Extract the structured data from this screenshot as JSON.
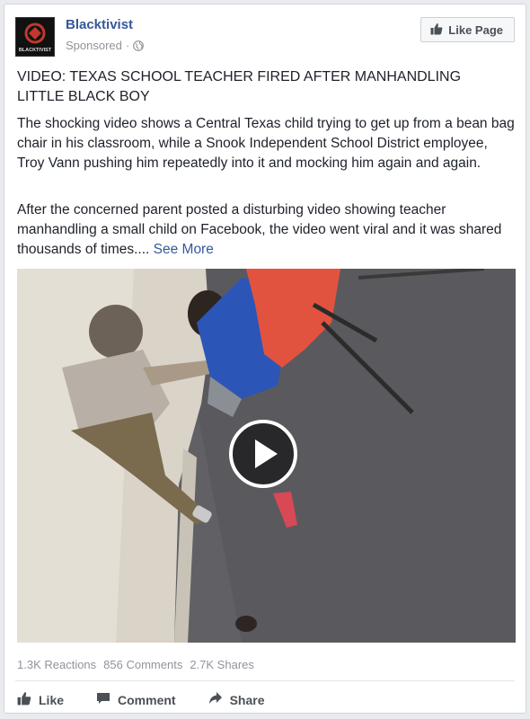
{
  "post": {
    "page_name": "Blacktivist",
    "avatar_text": "BLACKTIVIST",
    "sponsored_label": "Sponsored",
    "sponsored_separator": "·",
    "like_page_label": "Like Page",
    "headline": "VIDEO: TEXAS SCHOOL TEACHER FIRED AFTER MANHANDLING LITTLE BLACK BOY",
    "paragraph1": "The shocking video shows a Central Texas child trying to get up from a bean bag chair in his classroom, while a Snook Independent School District employee, Troy Vann pushing him repeatedly into it and mocking him again and again.",
    "paragraph2": "After the concerned parent posted a disturbing video showing teacher manhandling a small child on Facebook, the video went viral and it was shared thousands of times....",
    "see_more": "See More"
  },
  "stats": {
    "reactions": "1.3K Reactions",
    "comments": "856 Comments",
    "shares": "2.7K Shares"
  },
  "actions": {
    "like": "Like",
    "comment": "Comment",
    "share": "Share"
  },
  "icons": {
    "avatar": "blacktivist-logo-icon",
    "globe": "globe-icon",
    "thumbs_up": "thumbs-up-icon",
    "comment": "comment-bubble-icon",
    "share": "share-arrow-icon",
    "play": "play-icon"
  },
  "colors": {
    "link": "#365899",
    "secondary_text": "#90949c",
    "body_text": "#1d2129"
  }
}
